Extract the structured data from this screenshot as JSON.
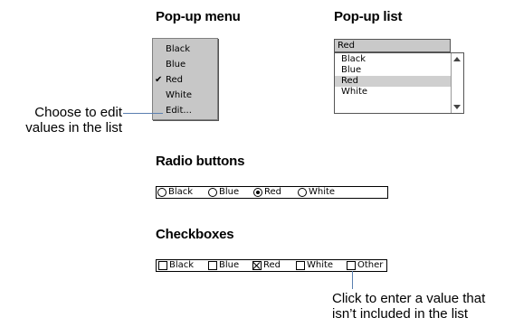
{
  "headings": {
    "popup_menu": "Pop-up menu",
    "popup_list": "Pop-up list",
    "radio_buttons": "Radio buttons",
    "checkboxes": "Checkboxes"
  },
  "popup_menu": {
    "items": [
      {
        "label": "Black",
        "checked": false
      },
      {
        "label": "Blue",
        "checked": false
      },
      {
        "label": "Red",
        "checked": true
      },
      {
        "label": "White",
        "checked": false
      },
      {
        "label": "Edit...",
        "checked": false
      }
    ]
  },
  "popup_list": {
    "value": "Red",
    "items": [
      {
        "label": "Black",
        "selected": false
      },
      {
        "label": "Blue",
        "selected": false
      },
      {
        "label": "Red",
        "selected": true
      },
      {
        "label": "White",
        "selected": false
      }
    ]
  },
  "radio_buttons": {
    "options": [
      {
        "label": "Black",
        "selected": false
      },
      {
        "label": "Blue",
        "selected": false
      },
      {
        "label": "Red",
        "selected": true
      },
      {
        "label": "White",
        "selected": false
      }
    ]
  },
  "checkboxes": {
    "options": [
      {
        "label": "Black",
        "checked": false
      },
      {
        "label": "Blue",
        "checked": false
      },
      {
        "label": "Red",
        "checked": true
      },
      {
        "label": "White",
        "checked": false
      },
      {
        "label": "Other",
        "checked": false
      }
    ]
  },
  "callouts": {
    "edit_line1": "Choose to edit",
    "edit_line2": "values in the list",
    "other_line1": "Click to enter a value that",
    "other_line2": "isn’t included in the list"
  },
  "colors": {
    "callout_line": "#5a7fb0",
    "menu_bg": "#c7c7c7",
    "selected_row": "#cfcfcf"
  }
}
